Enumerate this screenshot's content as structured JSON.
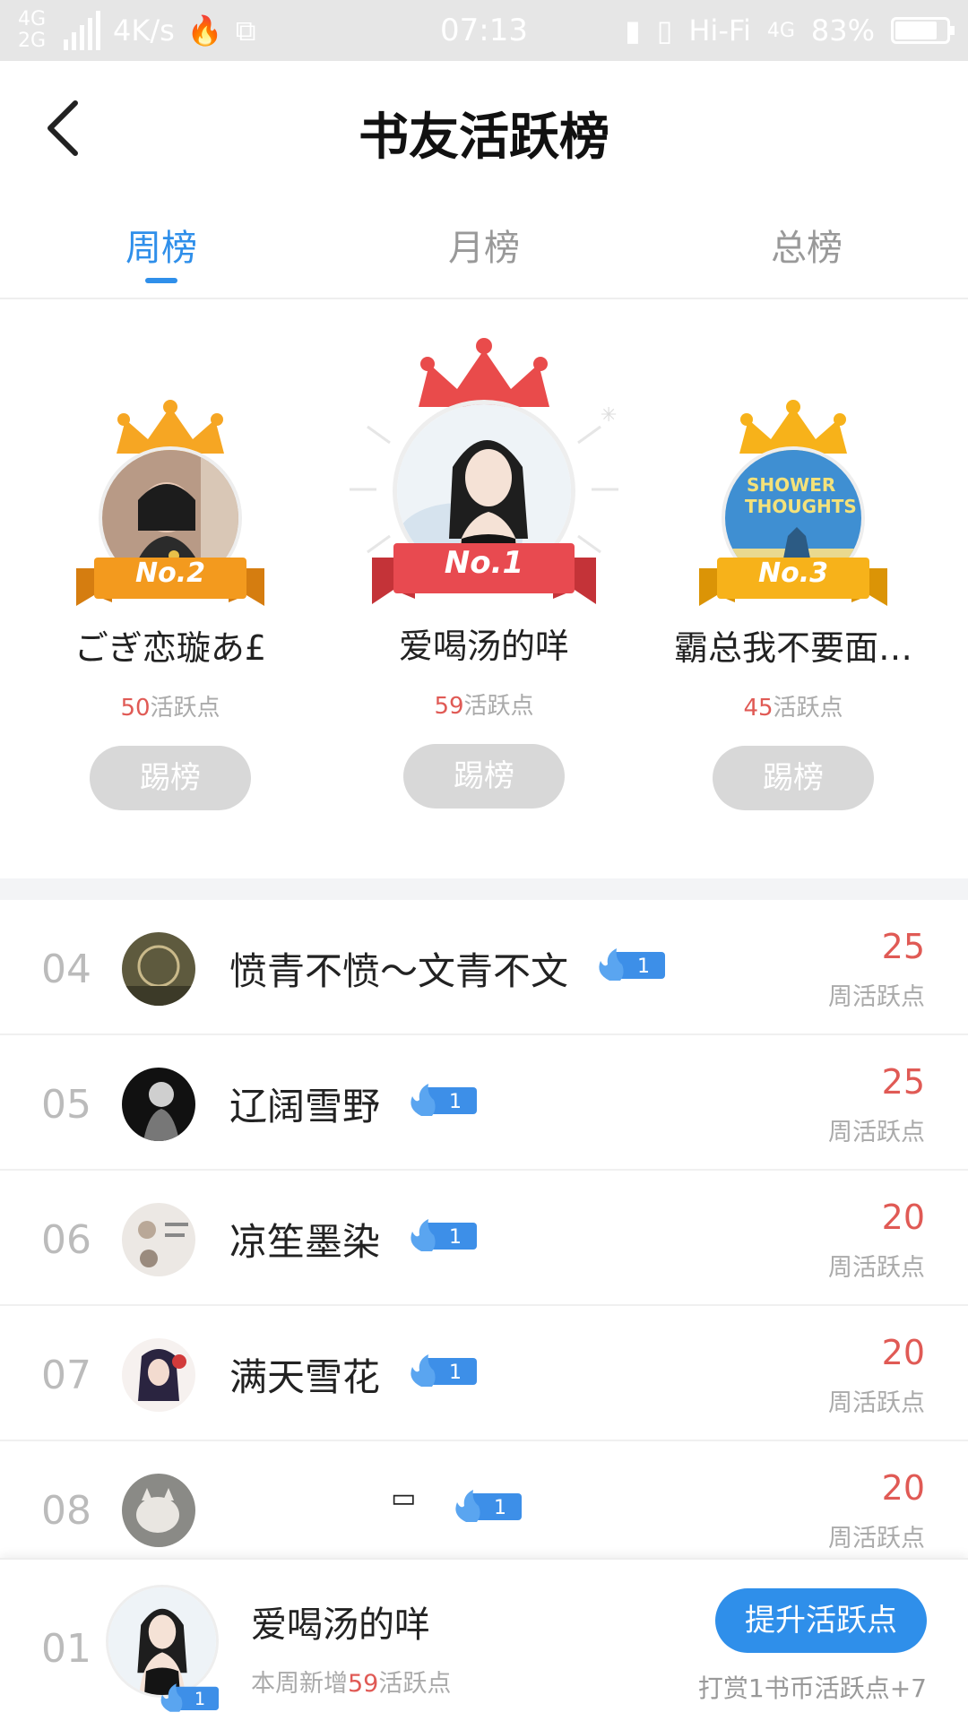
{
  "status_bar": {
    "net_top": "4G",
    "net_bottom": "2G",
    "speed": "4K/s",
    "time": "07:13",
    "hifi": "Hi-Fi",
    "net_right": "4G",
    "battery": "83%",
    "battery_level": 0.83
  },
  "header": {
    "title": "书友活跃榜"
  },
  "tabs": [
    {
      "label": "周榜",
      "active": true
    },
    {
      "label": "月榜",
      "active": false
    },
    {
      "label": "总榜",
      "active": false
    }
  ],
  "podium": [
    {
      "rank_label": "No.2",
      "name": "ごぎ恋璇あ£",
      "score": "50",
      "unit": "活跃点",
      "button": "踢榜"
    },
    {
      "rank_label": "No.1",
      "name": "爱喝汤的咩",
      "score": "59",
      "unit": "活跃点",
      "button": "踢榜"
    },
    {
      "rank_label": "No.3",
      "name": "霸总我不要面…",
      "score": "45",
      "unit": "活跃点",
      "button": "踢榜"
    }
  ],
  "list": [
    {
      "rank": "04",
      "name": "愤青不愤～文青不文",
      "badge": "1",
      "score": "25",
      "unit": "周活跃点"
    },
    {
      "rank": "05",
      "name": "辽阔雪野",
      "badge": "1",
      "score": "25",
      "unit": "周活跃点"
    },
    {
      "rank": "06",
      "name": "凉笙墨染",
      "badge": "1",
      "score": "20",
      "unit": "周活跃点"
    },
    {
      "rank": "07",
      "name": "满天雪花",
      "badge": "1",
      "score": "20",
      "unit": "周活跃点"
    },
    {
      "rank": "08",
      "name": "▭",
      "badge": "1",
      "score": "20",
      "unit": "周活跃点"
    }
  ],
  "me": {
    "rank": "01",
    "name": "爱喝汤的咩",
    "badge": "1",
    "week_prefix": "本周新增",
    "week_value": "59",
    "week_suffix": "活跃点",
    "button": "提升活跃点",
    "tip": "打赏1书币活跃点+7"
  },
  "colors": {
    "accent": "#2f8fea",
    "score_red": "#e05a55",
    "crown_gold": "#f6a623",
    "crown_red": "#e94b4b",
    "ribbon_orange": "#f39a1e",
    "ribbon_red": "#e84a50",
    "ribbon_yellow": "#f7b21a"
  }
}
